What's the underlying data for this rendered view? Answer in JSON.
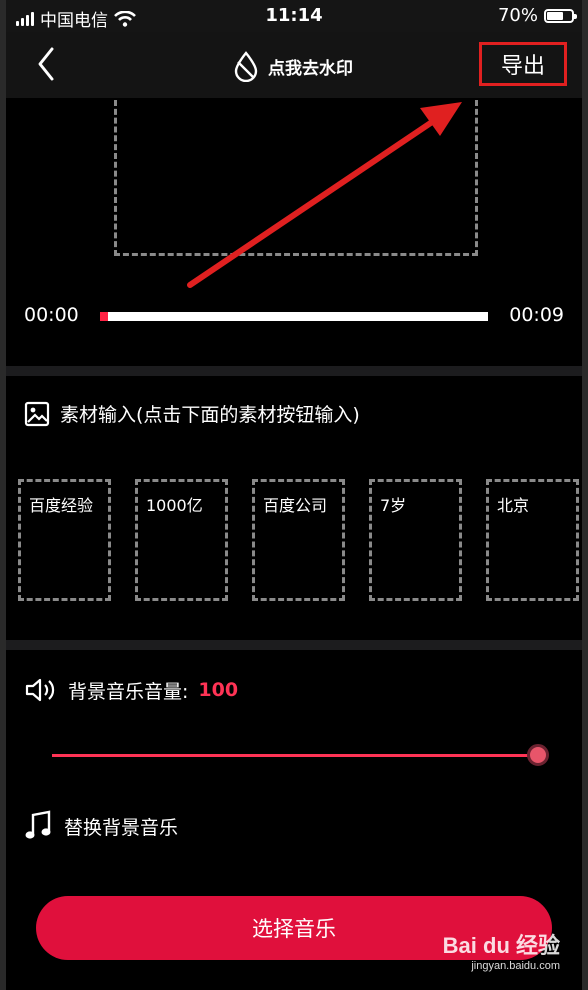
{
  "status_bar": {
    "carrier": "中国电信",
    "time": "11:14",
    "battery": "70%",
    "battery_level": 0.7
  },
  "nav": {
    "title": "点我去水印",
    "export_label": "导出",
    "icons": {
      "back": "chevron-left-icon",
      "title": "water-drop-icon"
    }
  },
  "preview": {
    "time_start": "00:00",
    "time_end": "00:09",
    "progress": 0.02
  },
  "material": {
    "header": "素材输入(点击下面的素材按钮输入)",
    "items": [
      "百度经验",
      "1000亿",
      "百度公司",
      "7岁",
      "北京"
    ]
  },
  "music": {
    "volume_label": "背景音乐音量:",
    "volume_value": "100",
    "volume_level": 1.0,
    "replace_label": "替换背景音乐",
    "select_button": "选择音乐"
  },
  "colors": {
    "accent": "#e0103c",
    "highlight": "#ff3355",
    "annotation": "#e02020"
  },
  "watermark": {
    "logo": "Bai du 经验",
    "url": "jingyan.baidu.com"
  }
}
